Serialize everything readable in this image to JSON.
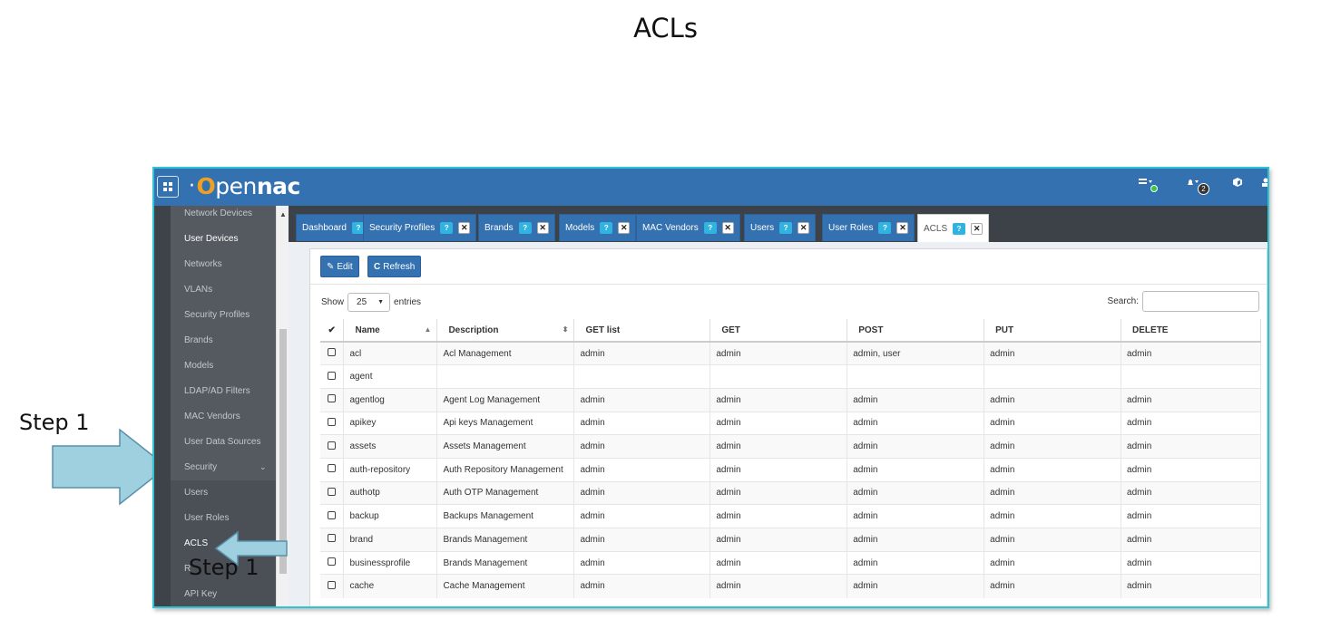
{
  "slide": {
    "title": "ACLs",
    "step_left": "Step 1",
    "step_bottom": "Step 1"
  },
  "navbar": {
    "logo_prefix": "·",
    "logo_o": "O",
    "logo_pen": "pen",
    "logo_nac": "nac",
    "badge_count": "2"
  },
  "sidebar": {
    "items": [
      {
        "label": "Network Devices",
        "active": false
      },
      {
        "label": "User Devices",
        "active": true
      },
      {
        "label": "Networks",
        "active": false
      },
      {
        "label": "VLANs",
        "active": false
      },
      {
        "label": "Security Profiles",
        "active": false
      },
      {
        "label": "Brands",
        "active": false
      },
      {
        "label": "Models",
        "active": false
      },
      {
        "label": "LDAP/AD Filters",
        "active": false
      },
      {
        "label": "MAC Vendors",
        "active": false
      },
      {
        "label": "User Data Sources",
        "active": false
      },
      {
        "label": "Security",
        "active": false
      },
      {
        "label": "Users",
        "active": false
      },
      {
        "label": "User Roles",
        "active": false
      },
      {
        "label": "ACLS",
        "active": true
      },
      {
        "label": "R",
        "active": false
      },
      {
        "label": "API Key",
        "active": false
      }
    ],
    "security_chevron": "⌄"
  },
  "tabs": [
    {
      "label": "Dashboard",
      "closable": false
    },
    {
      "label": "Security Profiles",
      "closable": true
    },
    {
      "label": "Brands",
      "closable": true
    },
    {
      "label": "Models",
      "closable": true
    },
    {
      "label": "MAC Vendors",
      "closable": true
    },
    {
      "label": "Users",
      "closable": true
    },
    {
      "label": "User Roles",
      "closable": true
    },
    {
      "label": "ACLS",
      "closable": true,
      "active": true
    }
  ],
  "toolbar": {
    "edit_label": "Edit",
    "refresh_label": "Refresh"
  },
  "table_controls": {
    "show": "Show",
    "page_size": "25",
    "entries": "entries",
    "search": "Search:"
  },
  "table": {
    "headers": [
      "✔",
      "Name",
      "Description",
      "GET list",
      "GET",
      "POST",
      "PUT",
      "DELETE"
    ],
    "rows": [
      [
        "acl",
        "Acl Management",
        "admin",
        "admin",
        "admin, user",
        "admin",
        "admin"
      ],
      [
        "agent",
        "",
        "",
        "",
        "",
        "",
        ""
      ],
      [
        "agentlog",
        "Agent Log Management",
        "admin",
        "admin",
        "admin",
        "admin",
        "admin"
      ],
      [
        "apikey",
        "Api keys Management",
        "admin",
        "admin",
        "admin",
        "admin",
        "admin"
      ],
      [
        "assets",
        "Assets Management",
        "admin",
        "admin",
        "admin",
        "admin",
        "admin"
      ],
      [
        "auth-repository",
        "Auth Repository Management",
        "admin",
        "admin",
        "admin",
        "admin",
        "admin"
      ],
      [
        "authotp",
        "Auth OTP Management",
        "admin",
        "admin",
        "admin",
        "admin",
        "admin"
      ],
      [
        "backup",
        "Backups Management",
        "admin",
        "admin",
        "admin",
        "admin",
        "admin"
      ],
      [
        "brand",
        "Brands Management",
        "admin",
        "admin",
        "admin",
        "admin",
        "admin"
      ],
      [
        "businessprofile",
        "Brands Management",
        "admin",
        "admin",
        "admin",
        "admin",
        "admin"
      ],
      [
        "cache",
        "Cache Management",
        "admin",
        "admin",
        "admin",
        "admin",
        "admin"
      ]
    ]
  },
  "colors": {
    "brand_blue": "#3371b0",
    "accent_cyan": "#2fc3d3",
    "arrow_fill": "#9fd0e0"
  }
}
